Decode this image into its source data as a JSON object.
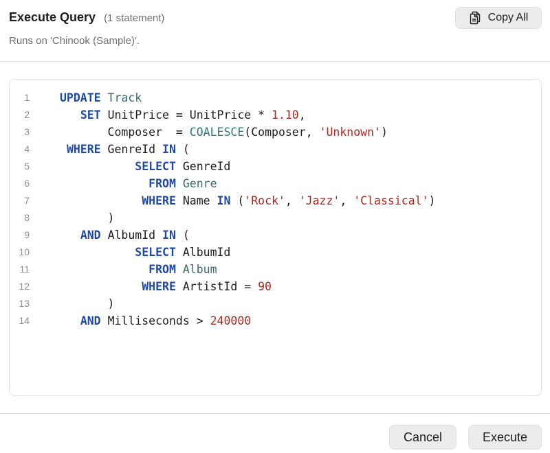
{
  "dialog": {
    "title": "Execute Query",
    "statement_count": "(1 statement)",
    "subtitle": "Runs on 'Chinook (Sample)'.",
    "copy_all_label": "Copy All",
    "cancel_label": "Cancel",
    "execute_label": "Execute"
  },
  "icons": {
    "copy": "copy-icon"
  },
  "colors": {
    "keyword": "#1f49a6",
    "table": "#3b6b6a",
    "function": "#2f7a78",
    "string": "#b3261e",
    "number": "#b3261e",
    "line_number": "#8e8e93",
    "button_bg": "#ececee"
  },
  "code": {
    "lines": [
      {
        "n": "1",
        "tokens": [
          [
            "kw",
            "UPDATE"
          ],
          [
            "sp",
            " "
          ],
          [
            "tbl",
            "Track"
          ]
        ]
      },
      {
        "n": "2",
        "tokens": [
          [
            "sp",
            "   "
          ],
          [
            "kw",
            "SET"
          ],
          [
            "sp",
            " "
          ],
          [
            "id",
            "UnitPrice"
          ],
          [
            "op",
            " = "
          ],
          [
            "id",
            "UnitPrice"
          ],
          [
            "op",
            " * "
          ],
          [
            "num",
            "1.10"
          ],
          [
            "op",
            ","
          ]
        ]
      },
      {
        "n": "3",
        "tokens": [
          [
            "sp",
            "       "
          ],
          [
            "id",
            "Composer"
          ],
          [
            "op",
            "  = "
          ],
          [
            "fn",
            "COALESCE"
          ],
          [
            "op",
            "("
          ],
          [
            "id",
            "Composer"
          ],
          [
            "op",
            ", "
          ],
          [
            "str",
            "'Unknown'"
          ],
          [
            "op",
            ")"
          ]
        ]
      },
      {
        "n": "4",
        "tokens": [
          [
            "sp",
            " "
          ],
          [
            "kw",
            "WHERE"
          ],
          [
            "sp",
            " "
          ],
          [
            "id",
            "GenreId"
          ],
          [
            "sp",
            " "
          ],
          [
            "kw",
            "IN"
          ],
          [
            "op",
            " ("
          ]
        ]
      },
      {
        "n": "5",
        "tokens": [
          [
            "sp",
            "           "
          ],
          [
            "kw",
            "SELECT"
          ],
          [
            "sp",
            " "
          ],
          [
            "id",
            "GenreId"
          ]
        ]
      },
      {
        "n": "6",
        "tokens": [
          [
            "sp",
            "             "
          ],
          [
            "kw",
            "FROM"
          ],
          [
            "sp",
            " "
          ],
          [
            "tbl",
            "Genre"
          ]
        ]
      },
      {
        "n": "7",
        "tokens": [
          [
            "sp",
            "            "
          ],
          [
            "kw",
            "WHERE"
          ],
          [
            "sp",
            " "
          ],
          [
            "id",
            "Name"
          ],
          [
            "sp",
            " "
          ],
          [
            "kw",
            "IN"
          ],
          [
            "op",
            " ("
          ],
          [
            "str",
            "'Rock'"
          ],
          [
            "op",
            ", "
          ],
          [
            "str",
            "'Jazz'"
          ],
          [
            "op",
            ", "
          ],
          [
            "str",
            "'Classical'"
          ],
          [
            "op",
            ")"
          ]
        ]
      },
      {
        "n": "8",
        "tokens": [
          [
            "sp",
            "       "
          ],
          [
            "op",
            ")"
          ]
        ]
      },
      {
        "n": "9",
        "tokens": [
          [
            "sp",
            "   "
          ],
          [
            "kw",
            "AND"
          ],
          [
            "sp",
            " "
          ],
          [
            "id",
            "AlbumId"
          ],
          [
            "sp",
            " "
          ],
          [
            "kw",
            "IN"
          ],
          [
            "op",
            " ("
          ]
        ]
      },
      {
        "n": "10",
        "tokens": [
          [
            "sp",
            "           "
          ],
          [
            "kw",
            "SELECT"
          ],
          [
            "sp",
            " "
          ],
          [
            "id",
            "AlbumId"
          ]
        ]
      },
      {
        "n": "11",
        "tokens": [
          [
            "sp",
            "             "
          ],
          [
            "kw",
            "FROM"
          ],
          [
            "sp",
            " "
          ],
          [
            "tbl",
            "Album"
          ]
        ]
      },
      {
        "n": "12",
        "tokens": [
          [
            "sp",
            "            "
          ],
          [
            "kw",
            "WHERE"
          ],
          [
            "sp",
            " "
          ],
          [
            "id",
            "ArtistId"
          ],
          [
            "op",
            " = "
          ],
          [
            "num",
            "90"
          ]
        ]
      },
      {
        "n": "13",
        "tokens": [
          [
            "sp",
            "       "
          ],
          [
            "op",
            ")"
          ]
        ]
      },
      {
        "n": "14",
        "tokens": [
          [
            "sp",
            "   "
          ],
          [
            "kw",
            "AND"
          ],
          [
            "sp",
            " "
          ],
          [
            "id",
            "Milliseconds"
          ],
          [
            "op",
            " > "
          ],
          [
            "num",
            "240000"
          ]
        ]
      }
    ]
  }
}
